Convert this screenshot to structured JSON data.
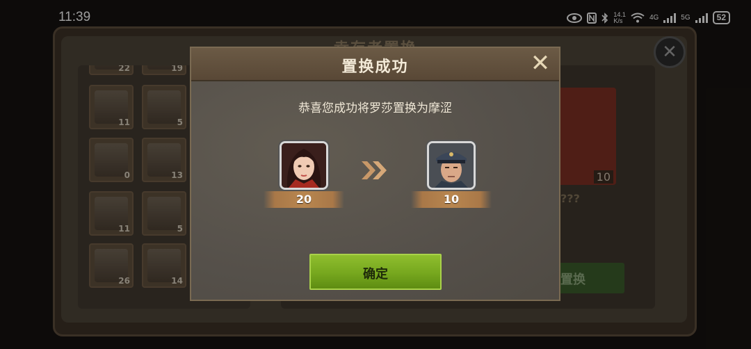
{
  "status_bar": {
    "time": "11:39",
    "net_speed_value": "14.1",
    "net_speed_unit": "K/s",
    "signal_1": "4G",
    "signal_2": "5G",
    "battery": "52"
  },
  "background": {
    "title": "幸存者置换",
    "list_counts": [
      "22",
      "19",
      "11",
      "5",
      "0",
      "13",
      "11",
      "5",
      "26",
      "14"
    ],
    "target_count": "10",
    "unknown_name": "???",
    "swap_button_label": "置换",
    "close_symbol": "✕"
  },
  "dialog": {
    "title": "置换成功",
    "close_symbol": "✕",
    "message": "恭喜您成功将罗莎置换为摩涩",
    "from_hero": {
      "level": "20"
    },
    "to_hero": {
      "level": "10"
    },
    "arrow_icon": "double-chevron-right-icon",
    "confirm_label": "确定"
  },
  "colors": {
    "confirm_green": "#7fb025",
    "header_brown": "#594836",
    "ribbon_brown": "#b8864f"
  }
}
